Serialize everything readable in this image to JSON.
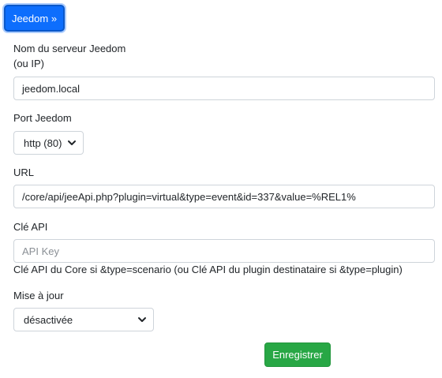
{
  "tab": {
    "label": "Jeedom »"
  },
  "server": {
    "label_line1": "Nom du serveur Jeedom",
    "label_line2": "(ou IP)",
    "value": "jeedom.local"
  },
  "port": {
    "label": "Port Jeedom",
    "selected": "http (80)"
  },
  "url": {
    "label": "URL",
    "value": "/core/api/jeeApi.php?plugin=virtual&type=event&id=337&value=%REL1%"
  },
  "api_key": {
    "label": "Clé API",
    "placeholder": "API Key",
    "help": "Clé API du Core si &type=scenario (ou Clé API du plugin destinataire si &type=plugin)"
  },
  "update": {
    "label": "Mise à jour",
    "selected": "désactivée"
  },
  "actions": {
    "save_label": "Enregistrer"
  },
  "colors": {
    "primary": "#0d6efd",
    "success": "#28a745"
  }
}
